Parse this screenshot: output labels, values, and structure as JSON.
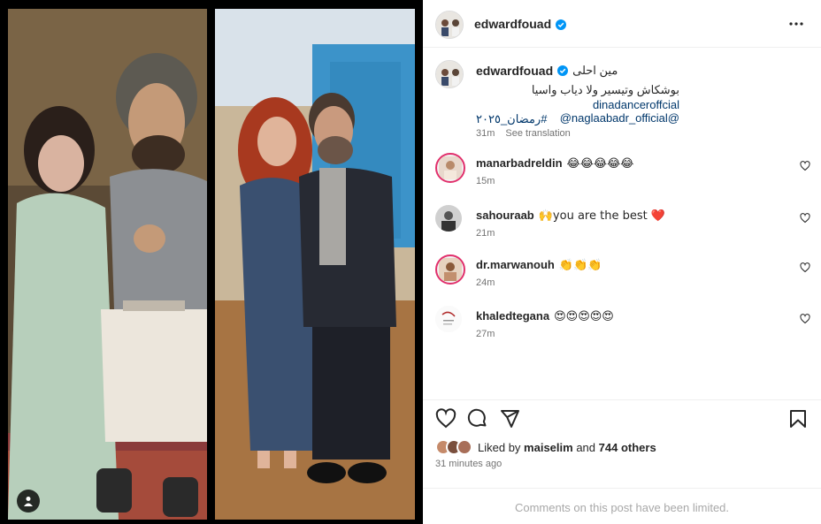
{
  "media": {
    "left_photo": {
      "alt": "two actors in costume"
    },
    "right_photo": {
      "alt": "two people posing"
    },
    "user_tag_icon": "person-icon"
  },
  "post": {
    "author": "edwardfouad",
    "more_icon": "ellipsis-icon",
    "caption": {
      "username": "edwardfouad",
      "line1": "مين احلى",
      "line2": "بوشكاش وتيسير ولا دياب واسيا",
      "line3": "dinadanceroffcial @naglaabadr_official@",
      "line4": "#رمضان_٢٠٢٥",
      "time": "31m",
      "see_translation": "See translation"
    },
    "comments": [
      {
        "username": "manarbadreldin",
        "text": "😂😂😂😂😂",
        "time": "15m"
      },
      {
        "username": "sahouraab",
        "text": "🙌you are the best ❤️",
        "time": "21m"
      },
      {
        "username": "dr.marwanouh",
        "text": "👏👏👏",
        "time": "24m"
      },
      {
        "username": "khaledtegana",
        "text": "😍😍😍😍😍",
        "time": "27m"
      }
    ],
    "likes": {
      "prefix": "Liked by",
      "user": "maiselim",
      "and": "and",
      "others": "744 others"
    },
    "posted_ago": "31 minutes ago",
    "comments_limited": "Comments on this post have been limited."
  },
  "colors": {
    "verified": "#0095f6",
    "link": "#00376b",
    "muted": "#737373",
    "ring": "#e1306c"
  }
}
